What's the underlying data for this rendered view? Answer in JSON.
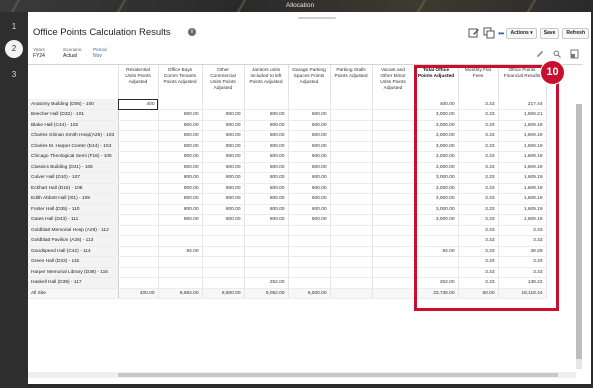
{
  "window": {
    "title": "Allocation"
  },
  "steps": [
    "1",
    "2",
    "3"
  ],
  "page": {
    "title": "Office Points Calculation Results",
    "info_icon": "info-icon"
  },
  "toolbar": {
    "edit_icon": "edit-icon",
    "copy_icon": "copy-icon",
    "more": "•••",
    "actions_label": "Actions ▾",
    "save_label": "Save",
    "refresh_label": "Refresh"
  },
  "pov": {
    "years_label": "Years",
    "years_value": "FY24",
    "scenario_label": "Scenario",
    "scenario_value": "Actual",
    "period_label": "Period",
    "period_value": "Nov"
  },
  "grid_tools": [
    "pencil-icon",
    "search-icon",
    "export-icon"
  ],
  "grid": {
    "columns": [
      "Residential Units Points Adjusted",
      "Office Bays Comm Tenants Points Adjusted",
      "Other Commercial Units Points Adjusted",
      "Janitors units included to left Points Adjusted",
      "Garage Parking Spaces Points Adjusted",
      "Parking Stalls Points Adjusted",
      "Vacant and Other Minor Units Points Adjusted",
      "Total Office Points Adjusted",
      "Monthly Flat Fees",
      "Office Points Financial Results"
    ],
    "rows": [
      {
        "name": "Anatomy Building (D06) - 100",
        "cells": [
          "400",
          "",
          "",
          "",
          "",
          "",
          "",
          "400.00",
          "3.33",
          "217.44"
        ]
      },
      {
        "name": "Beecher Hall (D32) - 101",
        "cells": [
          "",
          "800.00",
          "800.00",
          "800.00",
          "600.00",
          "",
          "",
          "3,000.00",
          "3.33",
          "1,609.21"
        ]
      },
      {
        "name": "Blake Hall (C44) - 102",
        "cells": [
          "",
          "800.00",
          "800.00",
          "800.00",
          "600.00",
          "",
          "",
          "3,000.00",
          "3.33",
          "1,609.19"
        ]
      },
      {
        "name": "Charles Gilman Smith Hosp(A25) - 103",
        "cells": [
          "",
          "800.00",
          "800.00",
          "800.00",
          "600.00",
          "",
          "",
          "3,000.00",
          "3.33",
          "1,609.19"
        ]
      },
      {
        "name": "Charles M. Harper Center (E44) - 104",
        "cells": [
          "",
          "800.00",
          "800.00",
          "800.00",
          "600.00",
          "",
          "",
          "3,000.00",
          "3.33",
          "1,609.19"
        ]
      },
      {
        "name": "Chicago Theological Semi (F16) - 105",
        "cells": [
          "",
          "800.00",
          "800.00",
          "800.00",
          "600.00",
          "",
          "",
          "3,000.00",
          "3.33",
          "1,609.19"
        ]
      },
      {
        "name": "Classics Building (D41) - 106",
        "cells": [
          "",
          "800.00",
          "800.00",
          "800.00",
          "600.00",
          "",
          "",
          "3,000.00",
          "3.33",
          "1,609.19"
        ]
      },
      {
        "name": "Culver Hall (D10) - 107",
        "cells": [
          "",
          "800.00",
          "800.00",
          "800.00",
          "600.00",
          "",
          "",
          "3,000.00",
          "3.33",
          "1,609.19"
        ]
      },
      {
        "name": "Eckhart Hall (D16) - 108",
        "cells": [
          "",
          "800.00",
          "800.00",
          "800.00",
          "600.00",
          "",
          "",
          "3,000.00",
          "3.33",
          "1,609.19"
        ]
      },
      {
        "name": "Edith Abbott Hall (I01) - 109",
        "cells": [
          "",
          "800.00",
          "800.00",
          "800.00",
          "600.00",
          "",
          "",
          "3,000.00",
          "3.33",
          "1,609.19"
        ]
      },
      {
        "name": "Foster Hall (D35) - 110",
        "cells": [
          "",
          "800.00",
          "800.00",
          "800.00",
          "600.00",
          "",
          "",
          "3,000.00",
          "3.33",
          "1,609.19"
        ]
      },
      {
        "name": "Gates Hall (D43) - 111",
        "cells": [
          "",
          "800.00",
          "800.00",
          "800.00",
          "600.00",
          "",
          "",
          "3,000.00",
          "3.33",
          "1,609.19"
        ]
      },
      {
        "name": "Goldblatt Memorial Hosp (A29) - 112",
        "cells": [
          "",
          "",
          "",
          "",
          "",
          "",
          "",
          "",
          "3.33",
          "3.33"
        ]
      },
      {
        "name": "Goldblatt Pavilion (A26) - 113",
        "cells": [
          "",
          "",
          "",
          "",
          "",
          "",
          "",
          "",
          "3.33",
          "3.33"
        ]
      },
      {
        "name": "Goodspeed Hall (C42) - 114",
        "cells": [
          "",
          "84.00",
          "",
          "",
          "",
          "",
          "",
          "84.00",
          "3.33",
          "48.29"
        ]
      },
      {
        "name": "Green Hall (D33) - 115",
        "cells": [
          "",
          "",
          "",
          "",
          "",
          "",
          "",
          "",
          "3.33",
          "3.33"
        ]
      },
      {
        "name": "Harper Memorial Library (D38) - 116",
        "cells": [
          "",
          "",
          "",
          "",
          "",
          "",
          "",
          "",
          "3.33",
          "3.33"
        ]
      },
      {
        "name": "Haskell Hall (D39) - 117",
        "cells": [
          "",
          "",
          "",
          "252.00",
          "",
          "",
          "",
          "252.00",
          "3.33",
          "138.22"
        ]
      },
      {
        "name": "All Site",
        "cells": [
          "400.00",
          "8,884.00",
          "8,800.00",
          "9,052.00",
          "6,600.00",
          "",
          "",
          "33,736.00",
          "60.00",
          "18,118.44"
        ]
      }
    ]
  },
  "callout": {
    "number": "10"
  },
  "colors": {
    "highlight": "#c8102e",
    "link": "#2a6fb5"
  }
}
